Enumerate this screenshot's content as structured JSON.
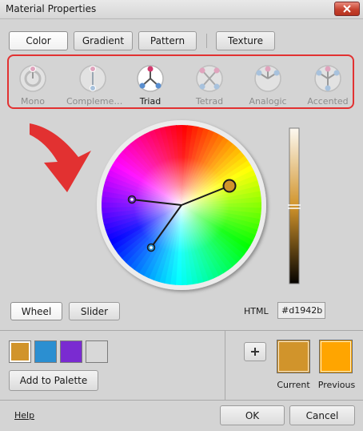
{
  "window": {
    "title": "Material Properties"
  },
  "tabs": [
    {
      "label": "Color",
      "active": true
    },
    {
      "label": "Gradient",
      "active": false
    },
    {
      "label": "Pattern",
      "active": false
    },
    {
      "label": "Texture",
      "active": false
    }
  ],
  "harmonies": [
    {
      "label": "Mono",
      "icon": "mono-harmony-icon",
      "selected": false
    },
    {
      "label": "Compleme…",
      "icon": "complementary-harmony-icon",
      "selected": false
    },
    {
      "label": "Triad",
      "icon": "triad-harmony-icon",
      "selected": true
    },
    {
      "label": "Tetrad",
      "icon": "tetrad-harmony-icon",
      "selected": false
    },
    {
      "label": "Analogic",
      "icon": "analogic-harmony-icon",
      "selected": false
    },
    {
      "label": "Accented",
      "icon": "accented-harmony-icon",
      "selected": false
    }
  ],
  "picker_modes": {
    "wheel": "Wheel",
    "slider": "Slider",
    "active": "Wheel"
  },
  "html": {
    "label": "HTML",
    "value": "#d1942b"
  },
  "palette": {
    "swatches": [
      "#d1942b",
      "#2b8fd1",
      "#7a2bd1",
      "#d8d8d8"
    ],
    "add_label": "Add to Palette"
  },
  "preview": {
    "current_label": "Current",
    "current_color": "#d1942b",
    "previous_label": "Previous",
    "previous_color": "#ffa500",
    "add_icon": "plus-icon"
  },
  "footer": {
    "help": "Help",
    "ok": "OK",
    "cancel": "Cancel"
  },
  "colors": {
    "annotation_red": "#e23131",
    "selected_harmony_dot": "#d23a6e"
  }
}
